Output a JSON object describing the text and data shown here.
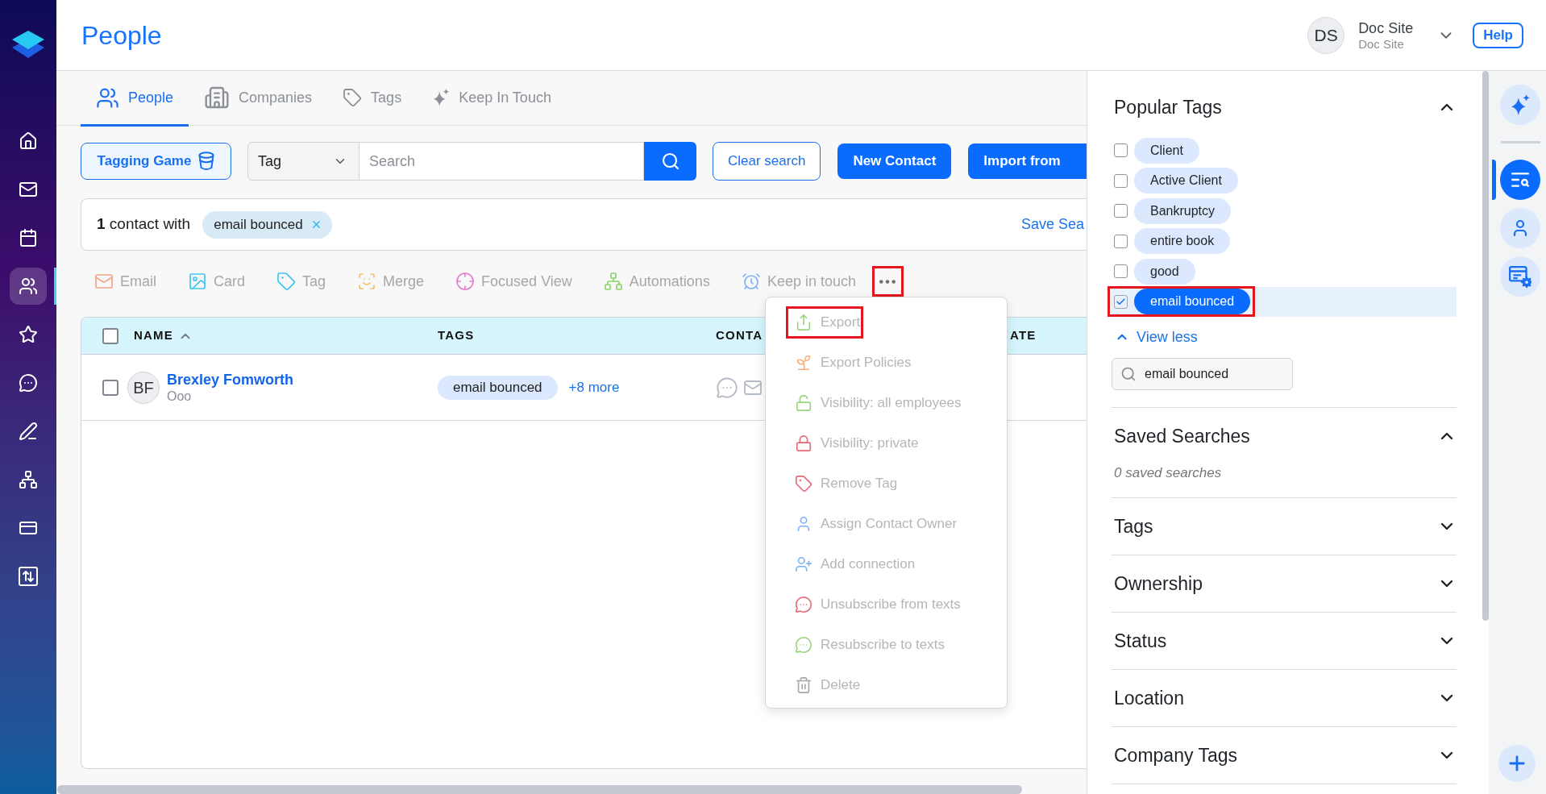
{
  "sidebar": {
    "items": [
      {
        "selected": false
      },
      {
        "selected": false
      },
      {
        "selected": false
      },
      {
        "selected": true
      },
      {
        "selected": false
      },
      {
        "selected": false
      },
      {
        "selected": false
      },
      {
        "selected": false
      },
      {
        "selected": false
      },
      {
        "selected": false
      }
    ]
  },
  "header": {
    "title": "People",
    "user": {
      "initials": "DS",
      "name": "Doc Site",
      "subtitle": "Doc Site"
    },
    "help": "Help"
  },
  "tabs": [
    {
      "label": "People",
      "selected": true
    },
    {
      "label": "Companies",
      "selected": false
    },
    {
      "label": "Tags",
      "selected": false
    },
    {
      "label": "Keep In Touch",
      "selected": false
    }
  ],
  "search_bar": {
    "tagging_game": "Tagging Game",
    "field": "Tag",
    "search": {
      "placeholder": "Search"
    },
    "buttons": [
      {
        "label": "Clear search",
        "kind": "outline"
      },
      {
        "label": "New Contact",
        "kind": "primary"
      },
      {
        "label": "Import from",
        "kind": "primary"
      }
    ]
  },
  "filter": {
    "summary": "**1** contact with",
    "tag": "email bounced",
    "save_search": "Save Sea"
  },
  "actions": [
    {
      "label": "Email",
      "disabled": true
    },
    {
      "label": "Card",
      "disabled": true
    },
    {
      "label": "Tag",
      "disabled": true
    },
    {
      "label": "Merge",
      "disabled": true
    },
    {
      "label": "Focused View",
      "disabled": true
    },
    {
      "label": "Automations",
      "disabled": true
    },
    {
      "label": "Keep in touch",
      "disabled": true
    }
  ],
  "more_button": {
    "highlighted": true
  },
  "table": {
    "select_all": {
      "checked": false
    },
    "columns": [
      {
        "label": "NAME",
        "sorted": true
      },
      {
        "label": "TAGS",
        "sorted": false
      },
      {
        "label": "CONTA",
        "sorted": false
      },
      {
        "label": "ATE",
        "sorted": false
      }
    ],
    "rows": [
      {
        "checked": false,
        "initials": "BF",
        "name": "Brexley Fomworth",
        "subtitle": "Ooo",
        "tag": "email bounced",
        "more_tags": "+8 more"
      }
    ]
  },
  "menu": {
    "items": [
      {
        "label": "Export",
        "disabled": true,
        "highlighted": true
      },
      {
        "label": "Export Policies",
        "disabled": true,
        "highlighted": false
      },
      {
        "label": "Visibility: all employees",
        "disabled": true,
        "highlighted": false
      },
      {
        "label": "Visibility: private",
        "disabled": true,
        "highlighted": false
      },
      {
        "label": "Remove Tag",
        "disabled": true,
        "highlighted": false
      },
      {
        "label": "Assign Contact Owner",
        "disabled": true,
        "highlighted": false
      },
      {
        "label": "Add connection",
        "disabled": true,
        "highlighted": false
      },
      {
        "label": "Unsubscribe from texts",
        "disabled": true,
        "highlighted": false
      },
      {
        "label": "Resubscribe to texts",
        "disabled": true,
        "highlighted": false
      },
      {
        "label": "Delete",
        "disabled": true,
        "highlighted": false
      }
    ]
  },
  "right_panel": {
    "popular_tags": {
      "title": "Popular Tags",
      "expanded": true,
      "tags": [
        {
          "label": "Client",
          "checked": false,
          "highlighted": false
        },
        {
          "label": "Active Client",
          "checked": false,
          "highlighted": false
        },
        {
          "label": "Bankruptcy",
          "checked": false,
          "highlighted": false
        },
        {
          "label": "entire book",
          "checked": false,
          "highlighted": false
        },
        {
          "label": "good",
          "checked": false,
          "highlighted": false
        },
        {
          "label": "email bounced",
          "checked": true,
          "highlighted": true
        }
      ],
      "view_less": "View less",
      "search": {
        "value": "email bounced"
      }
    },
    "sections": [
      {
        "title": "Saved Searches",
        "expanded": true,
        "note": "0 saved searches"
      },
      {
        "title": "Tags",
        "expanded": false
      },
      {
        "title": "Ownership",
        "expanded": false
      },
      {
        "title": "Status",
        "expanded": false
      },
      {
        "title": "Location",
        "expanded": false
      },
      {
        "title": "Company Tags",
        "expanded": false
      }
    ]
  },
  "rail": {
    "items": [
      {
        "selected": false
      },
      {
        "selected": true
      },
      {
        "selected": false
      },
      {
        "selected": false
      }
    ]
  }
}
